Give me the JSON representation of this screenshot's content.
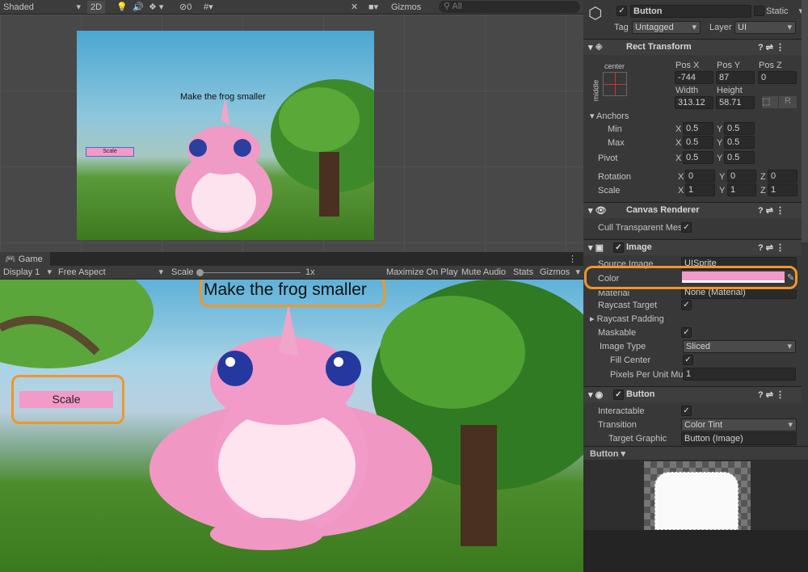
{
  "scene_toolbar": {
    "shading": "Shaded",
    "mode_2d": "2D",
    "hidden_count": "0",
    "gizmos": "Gizmos",
    "search_placeholder": "All"
  },
  "scene": {
    "title_text": "Make the frog smaller",
    "button_text": "Scale"
  },
  "game_tab": {
    "label": "Game",
    "display": "Display 1",
    "aspect": "Free Aspect",
    "scale_label": "Scale",
    "scale_value": "1x",
    "maximize": "Maximize On Play",
    "mute": "Mute Audio",
    "stats": "Stats",
    "gizmos": "Gizmos"
  },
  "game": {
    "title_text": "Make the frog smaller",
    "button_text": "Scale",
    "button_color": "#f29ac8"
  },
  "inspector": {
    "object_name": "Button",
    "static_label": "Static",
    "tag_label": "Tag",
    "tag_value": "Untagged",
    "layer_label": "Layer",
    "layer_value": "UI",
    "rect_transform": {
      "title": "Rect Transform",
      "anchor_h": "center",
      "anchor_v": "middle",
      "pos_x_label": "Pos X",
      "pos_y_label": "Pos Y",
      "pos_z_label": "Pos Z",
      "pos_x": "-744",
      "pos_y": "87",
      "pos_z": "0",
      "width_label": "Width",
      "height_label": "Height",
      "width": "313.12",
      "height": "58.71",
      "r_button": "R",
      "anchors_label": "Anchors",
      "min_label": "Min",
      "max_label": "Max",
      "pivot_label": "Pivot",
      "rotation_label": "Rotation",
      "scale_label": "Scale",
      "min": {
        "x": "0.5",
        "y": "0.5"
      },
      "max": {
        "x": "0.5",
        "y": "0.5"
      },
      "pivot": {
        "x": "0.5",
        "y": "0.5"
      },
      "rotation": {
        "x": "0",
        "y": "0",
        "z": "0"
      },
      "scale": {
        "x": "1",
        "y": "1",
        "z": "1"
      },
      "x": "X",
      "y": "Y",
      "z": "Z"
    },
    "canvas_renderer": {
      "title": "Canvas Renderer",
      "cull_label": "Cull Transparent Mes"
    },
    "image": {
      "title": "Image",
      "source_label": "Source Image",
      "source_value": "UISprite",
      "color_label": "Color",
      "color_value": "#f29ac8",
      "material_label": "Material",
      "material_value": "None (Material)",
      "raycast_target": "Raycast Target",
      "raycast_padding": "Raycast Padding",
      "maskable": "Maskable",
      "image_type_label": "Image Type",
      "image_type_value": "Sliced",
      "fill_center": "Fill Center",
      "ppu_label": "Pixels Per Unit Mul",
      "ppu_value": "1"
    },
    "button": {
      "title": "Button",
      "interactable": "Interactable",
      "transition_label": "Transition",
      "transition_value": "Color Tint",
      "target_label": "Target Graphic",
      "target_value": "Button (Image)"
    },
    "preview": {
      "label": "Button"
    }
  }
}
